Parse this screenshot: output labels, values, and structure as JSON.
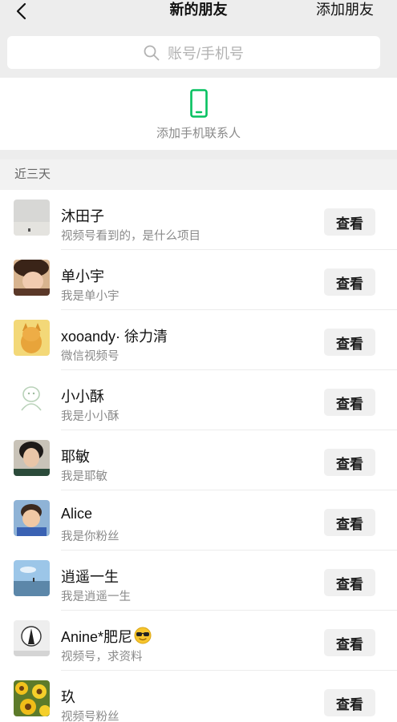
{
  "nav": {
    "back_icon": "chevron-left-icon",
    "title": "新的朋友",
    "add_label": "添加朋友"
  },
  "search": {
    "icon": "search-icon",
    "placeholder": "账号/手机号"
  },
  "add_phone_contacts": {
    "icon": "phone-icon",
    "label": "添加手机联系人",
    "icon_color": "#07c160"
  },
  "section": {
    "title": "近三天"
  },
  "requests": [
    {
      "name": "沐田子",
      "message": "视频号看到的，是什么项目",
      "button": "查看"
    },
    {
      "name": "单小宇",
      "message": "我是单小宇",
      "button": "查看"
    },
    {
      "name": "xooandy· 徐力清",
      "message": "微信视频号",
      "button": "查看"
    },
    {
      "name": "小小酥",
      "message": "我是小小酥",
      "button": "查看"
    },
    {
      "name": "耶敏",
      "message": "我是耶敏",
      "button": "查看"
    },
    {
      "name": "Alice",
      "message": "我是你粉丝",
      "button": "查看"
    },
    {
      "name": "逍遥一生",
      "message": "我是逍遥一生",
      "button": "查看"
    },
    {
      "name": "Anine*肥尼",
      "name_emoji": "sunglasses-emoji",
      "message": "视频号，求资料",
      "button": "查看"
    },
    {
      "name": "玖",
      "message": "视频号粉丝",
      "button": "查看"
    }
  ]
}
